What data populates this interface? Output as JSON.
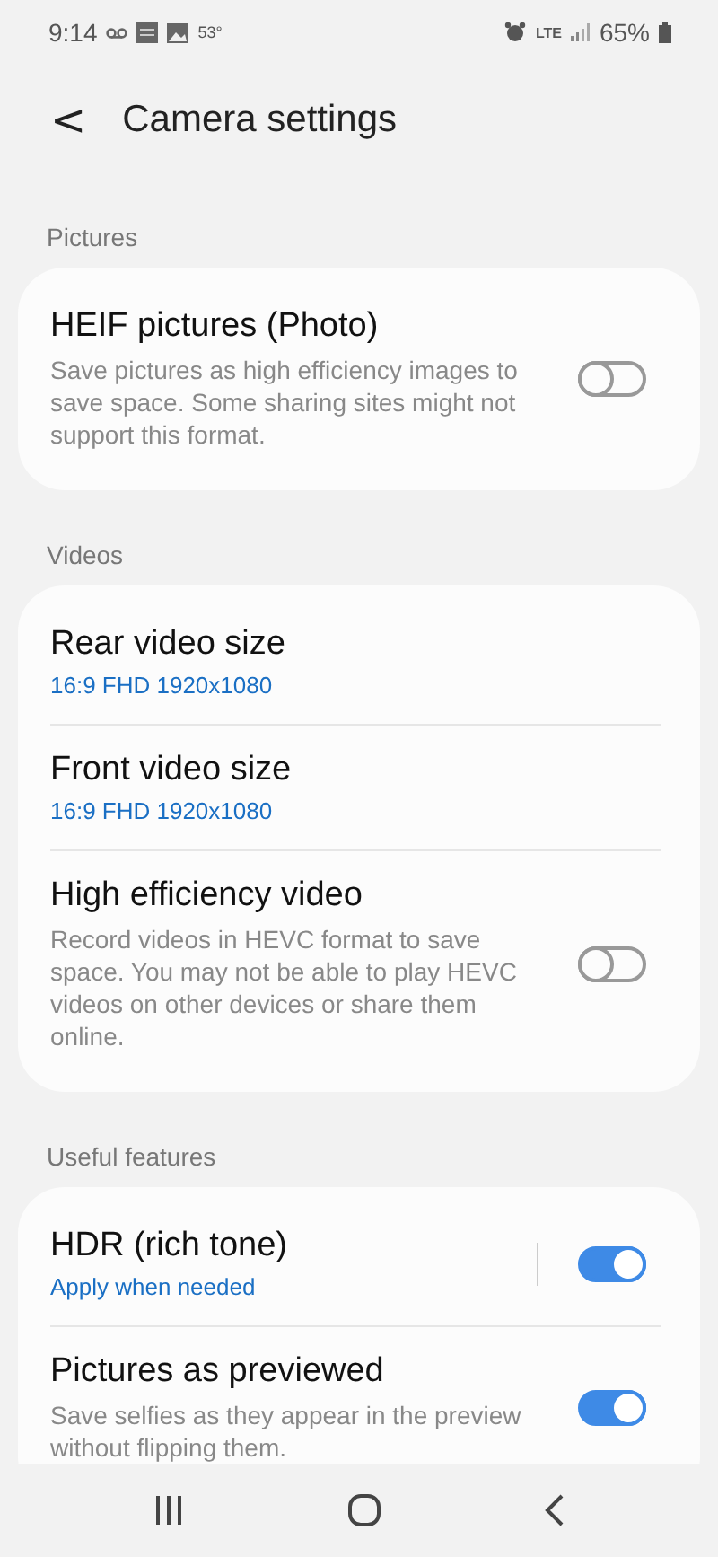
{
  "status_bar": {
    "time": "9:14",
    "temperature": "53°",
    "network": "LTE",
    "battery": "65%"
  },
  "header": {
    "back": "<",
    "title": "Camera settings"
  },
  "sections": [
    {
      "title": "Pictures",
      "items": [
        {
          "kind": "toggle",
          "title": "HEIF pictures (Photo)",
          "description": "Save pictures as high efficiency images to save space. Some sharing sites might not support this format.",
          "on": false
        }
      ]
    },
    {
      "title": "Videos",
      "items": [
        {
          "kind": "value",
          "title": "Rear video size",
          "value": "16:9 FHD 1920x1080"
        },
        {
          "kind": "value",
          "title": "Front video size",
          "value": "16:9 FHD 1920x1080"
        },
        {
          "kind": "toggle",
          "title": "High efficiency video",
          "description": "Record videos in HEVC format to save space. You may not be able to play HEVC videos on other devices or share them online.",
          "on": false
        }
      ]
    },
    {
      "title": "Useful features",
      "items": [
        {
          "kind": "value_toggle",
          "title": "HDR (rich tone)",
          "value": "Apply when needed",
          "on": true
        },
        {
          "kind": "toggle",
          "title": "Pictures as previewed",
          "description": "Save selfies as they appear in the preview without flipping them.",
          "on": true
        }
      ]
    }
  ]
}
